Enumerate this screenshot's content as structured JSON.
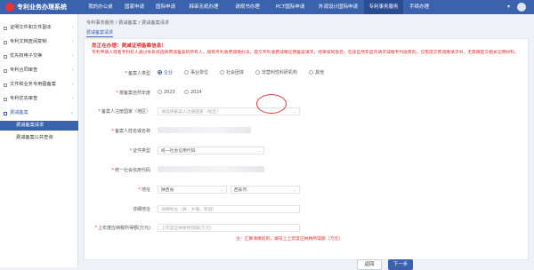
{
  "header": {
    "brand": "专利业务办理系统",
    "nav": [
      "我的办公桌",
      "国家申请",
      "国际申请",
      "韩审无纸办理",
      "请规书办理",
      "PCT国际申请",
      "外观设计国际申请",
      "专利事务服务",
      "手续办理"
    ],
    "more": "▾"
  },
  "sidebar": {
    "items": [
      {
        "label": "证明文件和文件副本"
      },
      {
        "label": "专利文档查阅复制"
      },
      {
        "label": "优先权电子交换"
      },
      {
        "label": "专利合同审查"
      },
      {
        "label": "文件和业务专用图备案"
      },
      {
        "label": "专利优先审查"
      },
      {
        "label": "费减备案"
      },
      {
        "label": "费减备案请求"
      },
      {
        "label": "费减备案公共查询"
      }
    ]
  },
  "breadcrumb": "专利事务服务 / 费减备案 / 费减备案请求",
  "tabs": [
    "费减备案请求"
  ],
  "notice": {
    "title": "您正在办理：费减证明备案信息！",
    "body": "专利申请人或者专利权人通过本系统选择费减备案的所有人，按照专利收费减缴办法，提交专利收费减缴证明备案请求，经审核同意后，在该自然年度内请求减缴专利收费的，仅需提交费减缴请求书，无需再提交相关证明材料。"
  },
  "form": {
    "applicant_type_label": "备案人类型",
    "applicant_types": [
      "企业",
      "事业单位",
      "社会团体",
      "非营利性科研机构",
      "其他"
    ],
    "year_label": "按备案自然年度",
    "years": [
      "2023",
      "2024"
    ],
    "region_label": "备案人注册国家（地区）",
    "region_placeholder": "请选择备案人注册国家（地区）",
    "name_label": "备案人姓名或名称",
    "cert_type_label": "证件类型",
    "cert_type_value": "统一社会信用代码",
    "cert_no_label": "统一社会信用代码",
    "address_label": "地址",
    "province": "陕西省",
    "city": "西安市",
    "detail_address_label": "详细地址",
    "detail_address_placeholder": "详细地址（县、乡镇、街道）",
    "income_label": "上年度应纳税所得额(万元)",
    "income_placeholder": "上年度应纳税所得额(万元)",
    "hint": "注：汇算清缴前的，填写上上年度应纳税所得额（万元）"
  },
  "buttons": {
    "back": "返回",
    "next": "下一步"
  },
  "colors": {
    "brand": "#3a62ad",
    "warning": "#e03030"
  }
}
